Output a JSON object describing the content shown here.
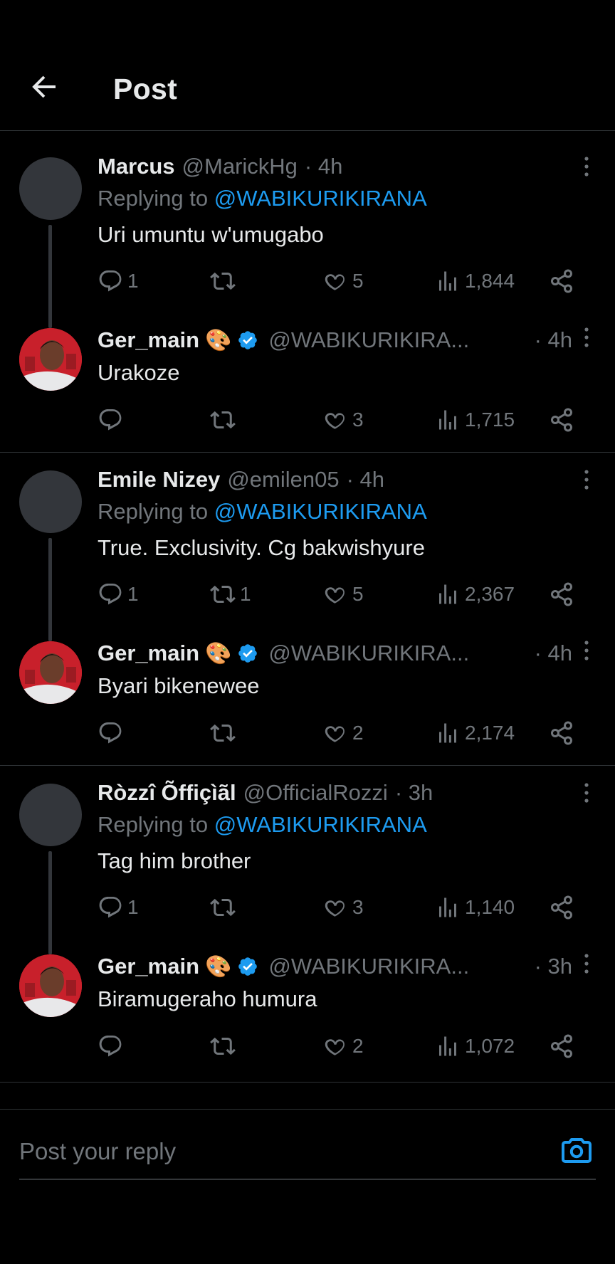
{
  "header": {
    "title": "Post"
  },
  "replying_label": "Replying to",
  "mention": "@WABIKURIKIRANA",
  "groups": [
    {
      "reply": {
        "name": "Marcus",
        "handle": "@MarickHg",
        "time": "· 4h",
        "text": "Uri umuntu w'umugabo",
        "replies": "1",
        "reposts": "",
        "likes": "5",
        "views": "1,844"
      },
      "author": {
        "name": "Ger_main",
        "emoji": "🎨",
        "handle": "@WABIKURIKIRA...",
        "time": "· 4h",
        "text": "Urakoze",
        "replies": "",
        "reposts": "",
        "likes": "3",
        "views": "1,715"
      }
    },
    {
      "reply": {
        "name": "Emile Nizey",
        "handle": "@emilen05",
        "time": "· 4h",
        "text": "True. Exclusivity. Cg bakwishyure",
        "replies": "1",
        "reposts": "1",
        "likes": "5",
        "views": "2,367"
      },
      "author": {
        "name": "Ger_main",
        "emoji": "🎨",
        "handle": "@WABIKURIKIRA...",
        "time": "· 4h",
        "text": "Byari bikenewee",
        "replies": "",
        "reposts": "",
        "likes": "2",
        "views": "2,174"
      }
    },
    {
      "reply": {
        "name": "Ròzzî Õffiçìãl",
        "handle": "@OfficialRozzi",
        "time": "· 3h",
        "text": "Tag him brother",
        "replies": "1",
        "reposts": "",
        "likes": "3",
        "views": "1,140"
      },
      "author": {
        "name": "Ger_main",
        "emoji": "🎨",
        "handle": "@WABIKURIKIRA...",
        "time": "· 3h",
        "text": "Biramugeraho humura",
        "replies": "",
        "reposts": "",
        "likes": "2",
        "views": "1,072"
      }
    }
  ],
  "composer": {
    "placeholder": "Post your reply"
  },
  "icons": {
    "back": "arrow-left-icon",
    "more": "more-vertical-icon",
    "reply": "reply-icon",
    "repost": "repost-icon",
    "like": "heart-icon",
    "views": "views-icon",
    "share": "share-icon",
    "camera": "camera-icon",
    "verified": "verified-badge-icon"
  },
  "colors": {
    "accent": "#1d9bf0",
    "muted": "#71767b",
    "text": "#e7e9ea",
    "background": "#000000",
    "divider": "#2f3336"
  }
}
